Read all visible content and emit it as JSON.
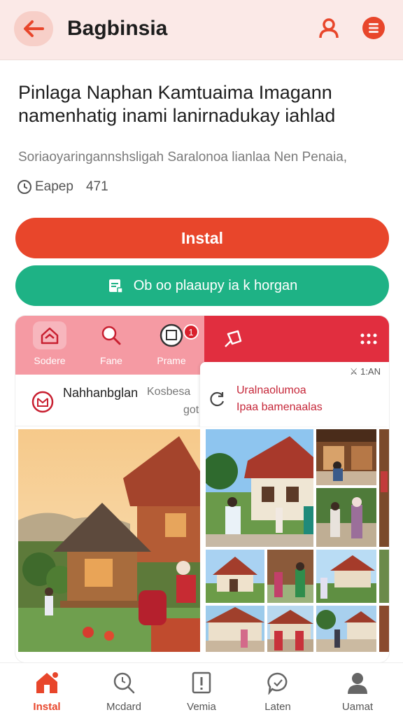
{
  "header": {
    "title": "Bagbinsia",
    "back_icon": "arrow-left-icon",
    "profile_icon": "user-icon",
    "menu_icon": "menu-circle-icon"
  },
  "app": {
    "heading": "Pinlaga Naphan Kamtuaima Imagann namenhatig inami lanirnadukay iahlad",
    "subtitle": "Soriaoyaringannshsligah Saralonoa lianlaa Nen Penaia,",
    "meta_label": "Eapep",
    "meta_count": "471"
  },
  "buttons": {
    "install": "Instal",
    "open": "Ob oo plaaupy ia k horgan"
  },
  "preview": {
    "tabs": [
      {
        "label": "Sodere",
        "icon": "home-icon"
      },
      {
        "label": "Fane",
        "icon": "search-icon"
      },
      {
        "label": "Prame",
        "icon": "message-icon"
      }
    ],
    "badge": "1",
    "row_name": "Nahhanbglan",
    "row_name2": "Kosbesa",
    "row_small": "got",
    "card_time": "⚔ 1:AN",
    "card_line1": "Uralnaolumoa",
    "card_line2": "Ipaa bamenaalas"
  },
  "bottom_nav": [
    {
      "label": "Instal",
      "icon": "home-icon",
      "active": true
    },
    {
      "label": "Mcdard",
      "icon": "search-icon",
      "active": false
    },
    {
      "label": "Vemia",
      "icon": "alert-box-icon",
      "active": false
    },
    {
      "label": "Laten",
      "icon": "chat-icon",
      "active": false
    },
    {
      "label": "Uamat",
      "icon": "user-icon",
      "active": false
    }
  ],
  "colors": {
    "accent": "#e8462b",
    "green": "#1eb285",
    "header_bg": "#fbe9e7",
    "preview_red": "#e12e3f",
    "preview_pink": "#f59aa3"
  }
}
